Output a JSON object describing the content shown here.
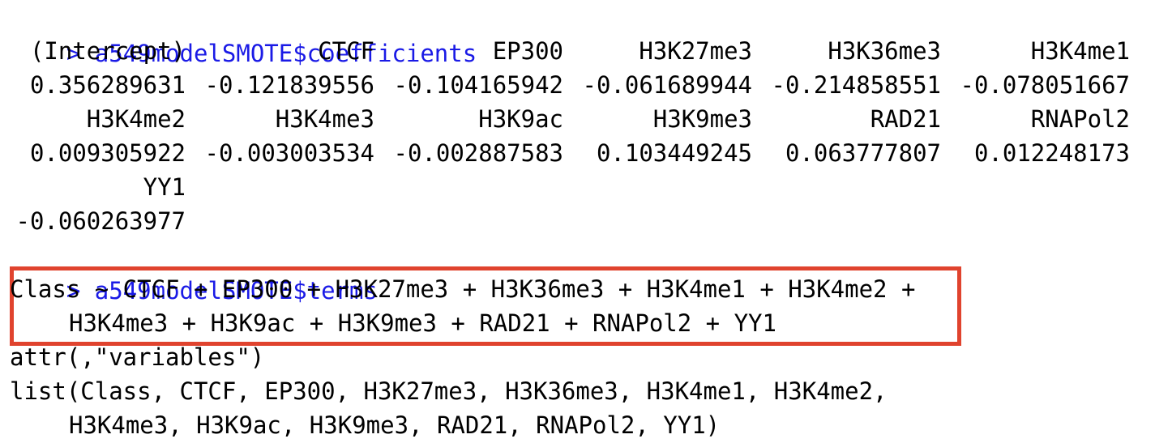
{
  "console": {
    "cmd1": {
      "prompt": ">",
      "text": "a549modelSMOTE$coefficients"
    },
    "coef_names_row1": [
      "(Intercept)",
      "CTCF",
      "EP300",
      "H3K27me3",
      "H3K36me3",
      "H3K4me1"
    ],
    "coef_values_row1": [
      "0.356289631",
      "-0.121839556",
      "-0.104165942",
      "-0.061689944",
      "-0.214858551",
      "-0.078051667"
    ],
    "coef_names_row2": [
      "H3K4me2",
      "H3K4me3",
      "H3K9ac",
      "H3K9me3",
      "RAD21",
      "RNAPol2"
    ],
    "coef_values_row2": [
      "0.009305922",
      "-0.003003534",
      "-0.002887583",
      "0.103449245",
      "0.063777807",
      "0.012248173"
    ],
    "coef_names_row3": [
      "YY1"
    ],
    "coef_values_row3": [
      "-0.060263977"
    ],
    "cmd2": {
      "prompt": ">",
      "text": "a549modelSMOTE$terms"
    },
    "terms_line1": "Class ~ CTCF + EP300 + H3K27me3 + H3K36me3 + H3K4me1 + H3K4me2 +",
    "terms_line2": "H3K4me3 + H3K9ac + H3K9me3 + RAD21 + RNAPol2 + YY1",
    "attr_line": "attr(,\"variables\")",
    "list_line1": "list(Class, CTCF, EP300, H3K27me3, H3K36me3, H3K4me1, H3K4me2,",
    "list_line2": "H3K4me3, H3K9ac, H3K9me3, RAD21, RNAPol2, YY1)"
  },
  "colors": {
    "command": "#1a1ae6",
    "output": "#000000",
    "highlight_border": "#e0432e"
  }
}
